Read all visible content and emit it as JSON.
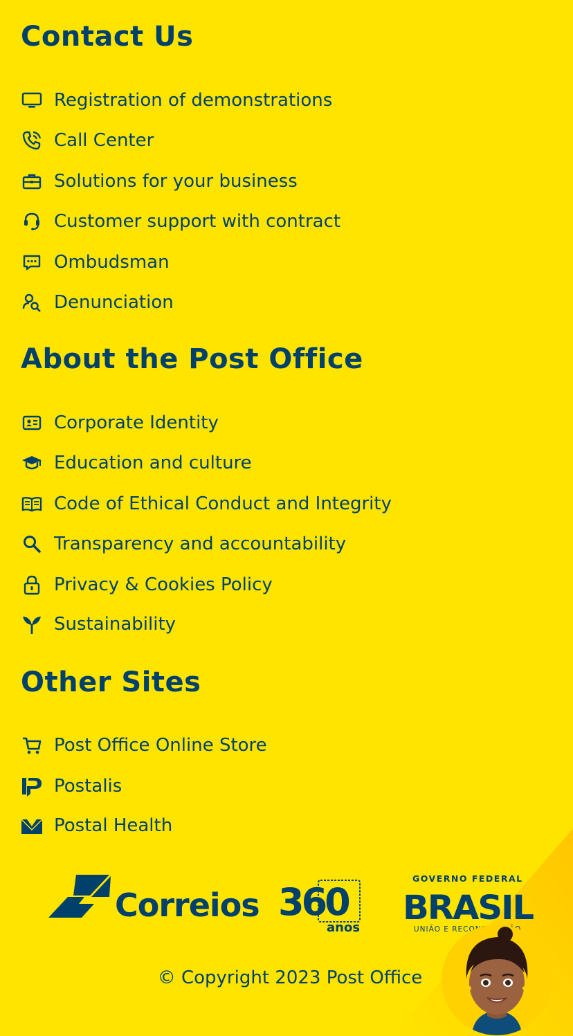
{
  "sections": {
    "contact": {
      "title": "Contact Us",
      "items": [
        {
          "label": "Registration of demonstrations",
          "icon": "monitor-icon"
        },
        {
          "label": "Call Center",
          "icon": "phone-icon"
        },
        {
          "label": "Solutions for your business",
          "icon": "briefcase-icon"
        },
        {
          "label": "Customer support with contract",
          "icon": "headset-icon"
        },
        {
          "label": "Ombudsman",
          "icon": "chat-bubble-icon"
        },
        {
          "label": "Denunciation",
          "icon": "user-search-icon"
        }
      ]
    },
    "about": {
      "title": "About the Post Office",
      "items": [
        {
          "label": "Corporate Identity",
          "icon": "id-card-icon"
        },
        {
          "label": "Education and culture",
          "icon": "graduation-cap-icon"
        },
        {
          "label": "Code of Ethical Conduct and Integrity",
          "icon": "open-book-icon"
        },
        {
          "label": "Transparency and accountability",
          "icon": "search-icon"
        },
        {
          "label": "Privacy & Cookies Policy",
          "icon": "lock-icon"
        },
        {
          "label": "Sustainability",
          "icon": "sprout-icon"
        }
      ]
    },
    "other": {
      "title": "Other Sites",
      "items": [
        {
          "label": "Post Office Online Store",
          "icon": "cart-icon"
        },
        {
          "label": "Postalis",
          "icon": "postalis-logo-icon"
        },
        {
          "label": "Postal Health",
          "icon": "postal-health-logo-icon"
        }
      ]
    }
  },
  "logos": {
    "correios": "Correios",
    "anniversary_number": "360",
    "anniversary_word": "anos",
    "gov_top": "GOVERNO FEDERAL",
    "gov_main": "BRASIL",
    "gov_bottom": "UNIÃO E RECONSTRUÇÃO"
  },
  "footer": {
    "copyright": "© Copyright 2023 Post Office"
  },
  "colors": {
    "background": "#FFE400",
    "primary": "#00416B",
    "accent": "#FFC600"
  }
}
